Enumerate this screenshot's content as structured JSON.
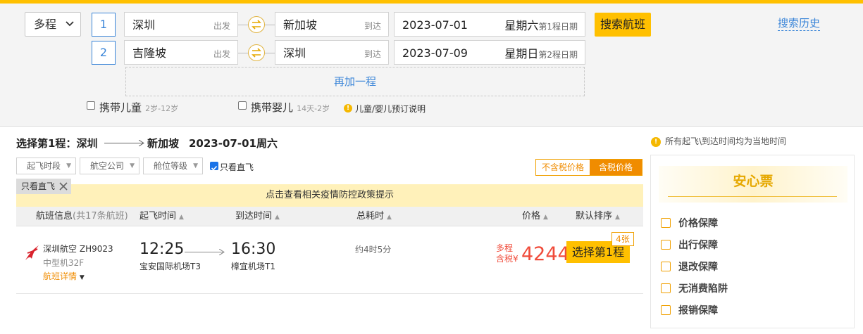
{
  "search": {
    "trip_type": "多程",
    "segments": [
      {
        "index": "1",
        "from": "深圳",
        "from_hint": "出发",
        "to": "新加坡",
        "to_hint": "到达",
        "date": "2023-07-01",
        "weekday": "星期六",
        "date_hint": "第1程日期"
      },
      {
        "index": "2",
        "from": "吉隆坡",
        "from_hint": "出发",
        "to": "深圳",
        "to_hint": "到达",
        "date": "2023-07-09",
        "weekday": "星期日",
        "date_hint": "第2程日期"
      }
    ],
    "search_button": "搜索航班",
    "history_link": "搜索历史",
    "add_trip": "再加一程",
    "child_label": "携带儿童",
    "child_age": "2岁-12岁",
    "infant_label": "携带婴儿",
    "infant_age": "14天-2岁",
    "booking_note": "儿童/婴儿预订说明"
  },
  "results": {
    "title_prefix": "选择第1程：",
    "from": "深圳",
    "to": "新加坡",
    "date": "2023-07-01周六",
    "filters": [
      "起飞时段",
      "航空公司",
      "舱位等级"
    ],
    "direct_only": "只看直飞",
    "active_tag": "只看直飞",
    "price_toggle": {
      "excl_tax": "不含税价格",
      "incl_tax": "含税价格"
    },
    "notice": "点击查看相关疫情防控政策提示",
    "columns": {
      "flight_info": "航班信息",
      "flight_count": "(共17条航班)",
      "depart": "起飞时间",
      "arrive": "到达时间",
      "duration": "总耗时",
      "price": "价格",
      "sort": "默认排序"
    },
    "flight": {
      "airline": "深圳航空",
      "number": "ZH9023",
      "aircraft": "中型机32F",
      "details": "航班详情",
      "depart_time": "12:25",
      "depart_airport": "宝安国际机场T3",
      "arrive_time": "16:30",
      "arrive_airport": "樟宜机场T1",
      "duration": "约4时5分",
      "price_tag_1": "多程",
      "price_tag_2": "含税",
      "currency": "¥",
      "price": "4244",
      "select_button": "选择第1程",
      "seats": "4张"
    }
  },
  "sidebar": {
    "note": "所有起飞\\到达时间均为当地时间",
    "title": "安心票",
    "guarantees": [
      "价格保障",
      "出行保障",
      "退改保障",
      "无消费陷阱",
      "报销保障"
    ]
  },
  "colors": {
    "accent": "#ffc000",
    "link": "#3a85d8",
    "price": "#f04b3a",
    "orange": "#f08c00"
  }
}
